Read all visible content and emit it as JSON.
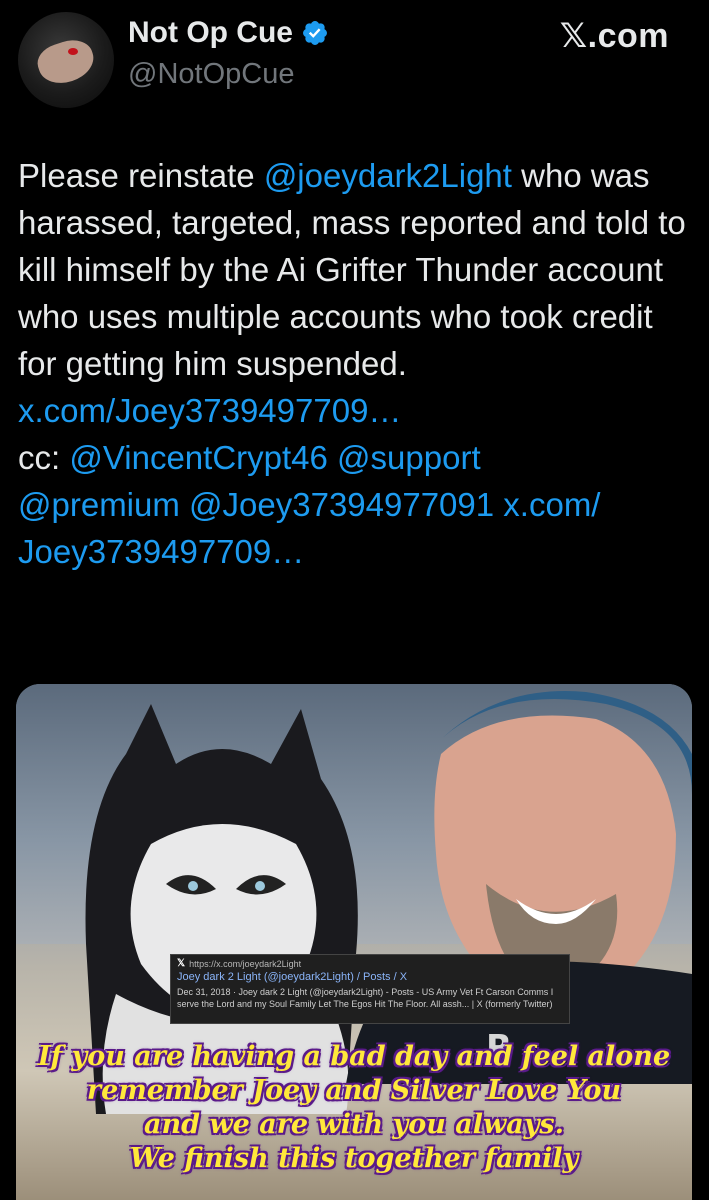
{
  "author": {
    "display_name": "Not Op Cue",
    "handle": "@NotOpCue",
    "verified": true
  },
  "site": {
    "logo_text": "𝕏.com"
  },
  "tweet": {
    "segments": [
      {
        "text": "Please reinstate ",
        "type": "text"
      },
      {
        "text": "@joeydark2Light",
        "type": "link"
      },
      {
        "text": " who was harassed, targeted, mass reported and told to kill himself by the Ai Grifter Thunder account who uses multiple accounts who took credit for getting him suspended.",
        "type": "text"
      },
      {
        "text": "x.com/Joey3739497709…",
        "type": "link"
      },
      {
        "text": "cc: ",
        "type": "text"
      },
      {
        "text": "@VincentCrypt46",
        "type": "link"
      },
      {
        "text": " ",
        "type": "text"
      },
      {
        "text": "@support",
        "type": "link"
      },
      {
        "text": "@premium",
        "type": "link"
      },
      {
        "text": " ",
        "type": "text"
      },
      {
        "text": "@Joey37394977091",
        "type": "link"
      },
      {
        "text": " ",
        "type": "text"
      },
      {
        "text": "x.com/ Joey3739497709…",
        "type": "link"
      }
    ]
  },
  "media": {
    "search_card": {
      "url": "https://x.com/joeydark2Light",
      "title": "Joey dark 2 Light (@joeydark2Light) / Posts / X",
      "snippet": "Dec 31, 2018 · Joey dark 2 Light (@joeydark2Light) - Posts - US Army Vet Ft Carson Comms I serve the Lord and my Soul Family Let The Egos Hit The Floor. All assh... | X (formerly Twitter)"
    },
    "overlay_lines": [
      "If you are having a bad day and feel alone",
      "remember Joey and Silver Love You",
      "and we are with you always.",
      "We finish this together family"
    ],
    "overlay_color": "#ffe83b",
    "overlay_outline": "#5a1a8a"
  },
  "colors": {
    "background": "#000000",
    "text": "#e7e9ea",
    "muted": "#71767b",
    "link": "#1d9bf0",
    "verified": "#1d9bf0"
  }
}
